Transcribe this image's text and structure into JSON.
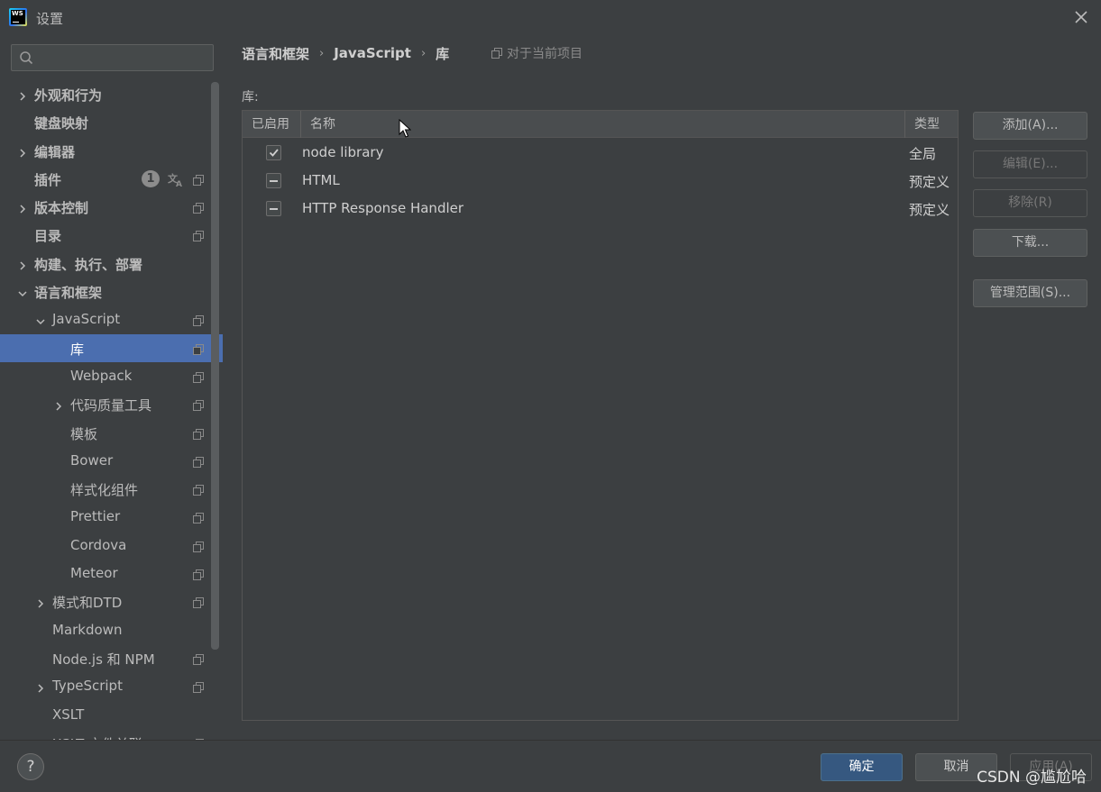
{
  "window": {
    "title": "设置",
    "logo_text": "WS"
  },
  "sidebar": {
    "search_placeholder": "",
    "items": [
      {
        "label": "外观和行为",
        "level": 0,
        "chevron": "right",
        "bold": true,
        "proj": false
      },
      {
        "label": "键盘映射",
        "level": 0,
        "chevron": "none",
        "bold": true,
        "proj": false
      },
      {
        "label": "编辑器",
        "level": 0,
        "chevron": "right",
        "bold": true,
        "proj": false
      },
      {
        "label": "插件",
        "level": 0,
        "chevron": "none",
        "bold": true,
        "proj": true,
        "badge": "1",
        "lang": true
      },
      {
        "label": "版本控制",
        "level": 0,
        "chevron": "right",
        "bold": true,
        "proj": true
      },
      {
        "label": "目录",
        "level": 0,
        "chevron": "none",
        "bold": true,
        "proj": true
      },
      {
        "label": "构建、执行、部署",
        "level": 0,
        "chevron": "right",
        "bold": true,
        "proj": false
      },
      {
        "label": "语言和框架",
        "level": 0,
        "chevron": "down",
        "bold": true,
        "proj": false
      },
      {
        "label": "JavaScript",
        "level": 1,
        "chevron": "down",
        "bold": false,
        "proj": true
      },
      {
        "label": "库",
        "level": 2,
        "chevron": "none",
        "bold": false,
        "proj": true,
        "selected": true
      },
      {
        "label": "Webpack",
        "level": 2,
        "chevron": "none",
        "bold": false,
        "proj": true
      },
      {
        "label": "代码质量工具",
        "level": 2,
        "chevron": "right",
        "bold": false,
        "proj": true
      },
      {
        "label": "模板",
        "level": 2,
        "chevron": "none",
        "bold": false,
        "proj": true
      },
      {
        "label": "Bower",
        "level": 2,
        "chevron": "none",
        "bold": false,
        "proj": true
      },
      {
        "label": "样式化组件",
        "level": 2,
        "chevron": "none",
        "bold": false,
        "proj": true
      },
      {
        "label": "Prettier",
        "level": 2,
        "chevron": "none",
        "bold": false,
        "proj": true
      },
      {
        "label": "Cordova",
        "level": 2,
        "chevron": "none",
        "bold": false,
        "proj": true
      },
      {
        "label": "Meteor",
        "level": 2,
        "chevron": "none",
        "bold": false,
        "proj": true
      },
      {
        "label": "模式和DTD",
        "level": 1,
        "chevron": "right",
        "bold": false,
        "proj": true
      },
      {
        "label": "Markdown",
        "level": 1,
        "chevron": "none",
        "bold": false,
        "proj": false
      },
      {
        "label": "Node.js 和 NPM",
        "level": 1,
        "chevron": "none",
        "bold": false,
        "proj": true
      },
      {
        "label": "TypeScript",
        "level": 1,
        "chevron": "right",
        "bold": false,
        "proj": true
      },
      {
        "label": "XSLT",
        "level": 1,
        "chevron": "none",
        "bold": false,
        "proj": false
      },
      {
        "label": "XSLT 文件关联",
        "level": 1,
        "chevron": "none",
        "bold": false,
        "proj": true
      }
    ]
  },
  "breadcrumb": {
    "items": [
      "语言和框架",
      "JavaScript",
      "库"
    ],
    "scope": "对于当前项目"
  },
  "libraries": {
    "label": "库:",
    "columns": [
      "已启用",
      "名称",
      "类型"
    ],
    "rows": [
      {
        "state": "checked",
        "name": "node library",
        "type": "全局"
      },
      {
        "state": "indeterminate",
        "name": "HTML",
        "type": "预定义"
      },
      {
        "state": "indeterminate",
        "name": "HTTP Response Handler",
        "type": "预定义"
      }
    ]
  },
  "actions": {
    "add": "添加(A)...",
    "edit": "编辑(E)...",
    "remove": "移除(R)",
    "download": "下载...",
    "manage_scopes": "管理范围(S)..."
  },
  "footer": {
    "help": "?",
    "ok": "确定",
    "cancel": "取消",
    "apply": "应用(A)"
  },
  "watermark": "CSDN @尴尬哈"
}
